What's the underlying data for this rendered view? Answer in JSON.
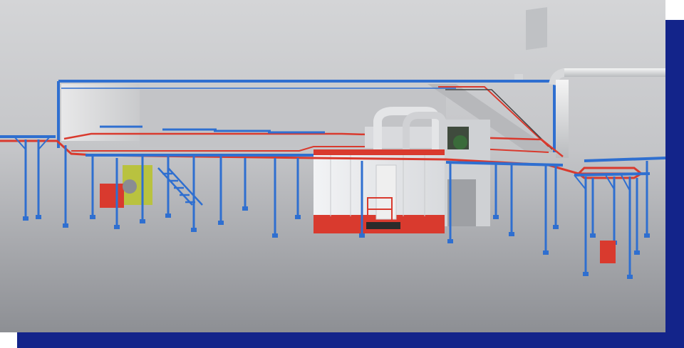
{
  "image": {
    "subject": "3d-render-powder-coating-line",
    "colors": {
      "frame": "#13248a",
      "steel_blue": "#2f6fd0",
      "conveyor_red": "#d93a2e",
      "booth_white": "#e9ebee",
      "floor_top": "#cfd0d2",
      "floor_bottom": "#8e9095"
    },
    "icons": [
      "overhead-conveyor-icon",
      "spray-booth-icon",
      "curing-oven-icon",
      "staircase-icon",
      "blower-unit-icon"
    ]
  }
}
